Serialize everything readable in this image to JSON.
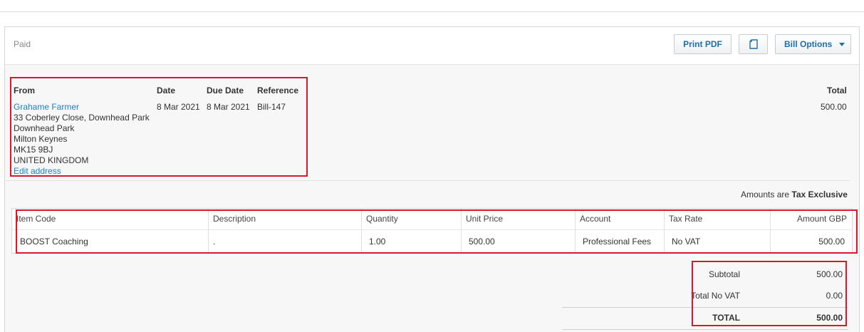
{
  "bill": {
    "status": "Paid",
    "print_pdf_label": "Print PDF",
    "options_label": "Bill Options"
  },
  "header": {
    "from_label": "From",
    "date_label": "Date",
    "due_date_label": "Due Date",
    "reference_label": "Reference",
    "total_label": "Total",
    "contact_name": "Grahame Farmer",
    "address": [
      "33 Coberley Close, Downhead Park",
      "Downhead Park",
      "Milton Keynes",
      "MK15 9BJ",
      "UNITED KINGDOM"
    ],
    "edit_address_label": "Edit address",
    "date": "8 Mar 2021",
    "due_date": "8 Mar 2021",
    "reference": "Bill-147",
    "total": "500.00"
  },
  "amounts_note": {
    "prefix": "Amounts are",
    "value": "Tax Exclusive"
  },
  "table": {
    "columns": [
      "Item Code",
      "Description",
      "Quantity",
      "Unit Price",
      "Account",
      "Tax Rate",
      "Amount GBP"
    ],
    "rows": [
      [
        "BOOST Coaching",
        ".",
        "1.00",
        "500.00",
        "Professional Fees",
        "No VAT",
        "500.00"
      ]
    ]
  },
  "totals": {
    "subtotal_label": "Subtotal",
    "subtotal": "500.00",
    "tax_label": "Total No VAT",
    "tax": "0.00",
    "total_label": "TOTAL",
    "total": "500.00"
  }
}
